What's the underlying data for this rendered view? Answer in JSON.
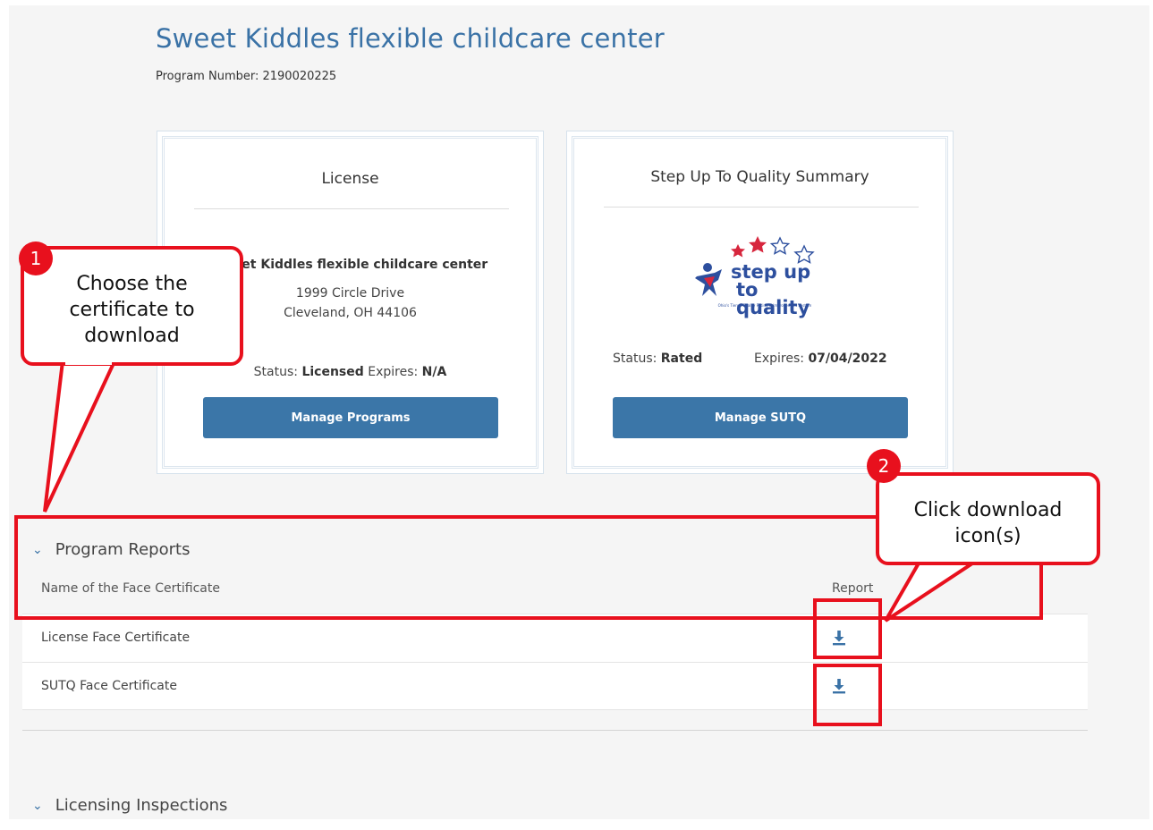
{
  "program": {
    "title": "Sweet Kiddles flexible childcare center",
    "number_label": "Program Number: 2190020225"
  },
  "license_card": {
    "title": "License",
    "name": "Sweet Kiddles flexible childcare center",
    "address_line1": "1999 Circle Drive",
    "address_line2": "Cleveland, OH 44106",
    "status_label": "Status:",
    "status_value": "Licensed",
    "expires_label": "Expires:",
    "expires_value": "N/A",
    "button_label": "Manage Programs"
  },
  "sutq_card": {
    "title": "Step Up To Quality Summary",
    "logo_line1": "step up",
    "logo_line2": "to quality",
    "logo_tagline": "Ohio's Tiered Quality Rating & Improvement System",
    "status_label": "Status:",
    "status_value": "Rated",
    "expires_label": "Expires:",
    "expires_value": "07/04/2022",
    "button_label": "Manage SUTQ"
  },
  "program_reports": {
    "heading": "Program Reports",
    "col_name": "Name of the Face Certificate",
    "col_report": "Report",
    "rows": [
      {
        "name": "License Face Certificate",
        "icon": "download-icon"
      },
      {
        "name": "SUTQ Face Certificate",
        "icon": "download-icon"
      }
    ]
  },
  "licensing_inspections": {
    "heading": "Licensing Inspections"
  },
  "annotations": {
    "step1_number": "1",
    "step1_line1": "Choose the",
    "step1_line2": "certificate to",
    "step1_line3": "download",
    "step2_number": "2",
    "step2_line1": "Click download",
    "step2_line2": "icon(s)"
  },
  "colors": {
    "accent": "#3a72a6",
    "button": "#3b76a8",
    "annotation_red": "#e8101d"
  }
}
